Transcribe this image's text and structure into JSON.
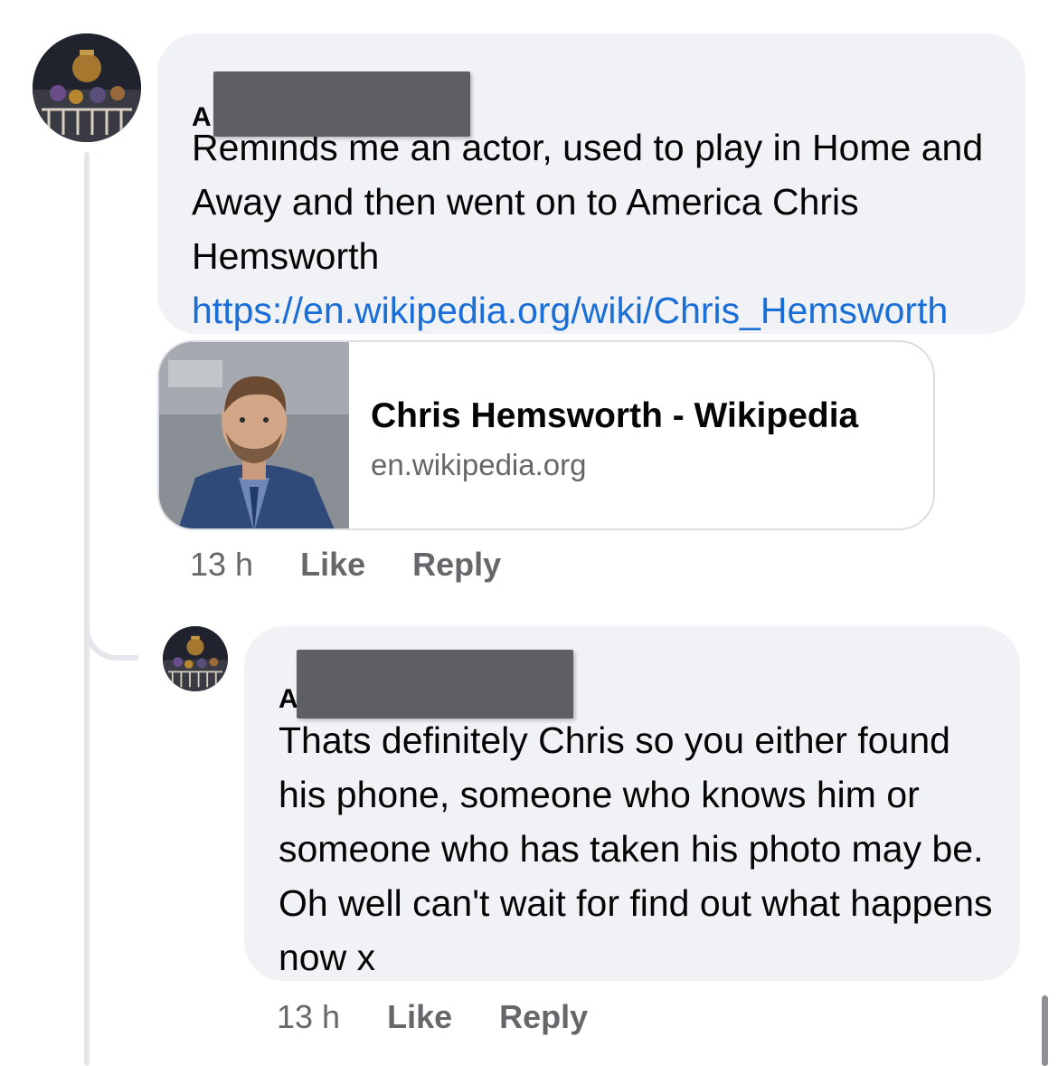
{
  "main_comment": {
    "author_initial": "A",
    "text": "Reminds me an actor, used to play in Home and Away and then went on to America Chris Hemsworth ",
    "link_text": "https://en.wikipedia.org/wiki/Chris_Hemsworth",
    "link_preview": {
      "title": "Chris Hemsworth - Wikipedia",
      "domain": "en.wikipedia.org"
    },
    "timestamp": "13 h",
    "like_label": "Like",
    "reply_label": "Reply"
  },
  "reply_comment": {
    "author_initial": "A",
    "text": "Thats definitely Chris so you either found his phone, someone who knows him or someone who has taken his photo may be. Oh well can't wait for find out what happens now x",
    "timestamp": "13 h",
    "like_label": "Like",
    "reply_label": "Reply"
  },
  "colors": {
    "bubble_bg": "#f0f2f5",
    "link": "#1a6ed8",
    "secondary_text": "#65676b",
    "redaction": "#5e5f62"
  }
}
